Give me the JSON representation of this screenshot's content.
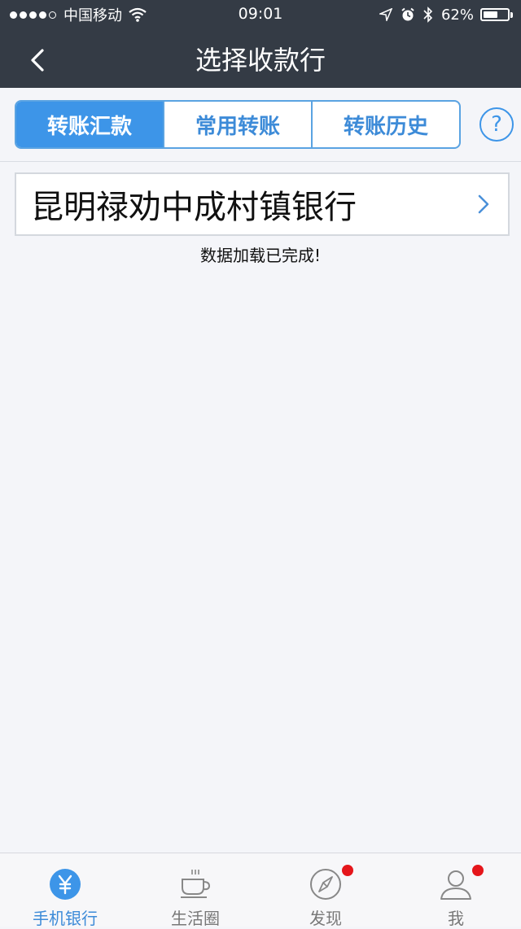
{
  "status": {
    "carrier": "中国移动",
    "time": "09:01",
    "battery": "62%",
    "battery_level": 0.62
  },
  "nav": {
    "title": "选择收款行"
  },
  "segments": [
    {
      "label": "转账汇款",
      "active": true
    },
    {
      "label": "常用转账",
      "active": false
    },
    {
      "label": "转账历史",
      "active": false
    }
  ],
  "help": {
    "label": "?"
  },
  "bank": {
    "name": "昆明禄劝中成村镇银行"
  },
  "load_message": "数据加载已完成!",
  "tabbar": [
    {
      "label": "手机银行",
      "icon": "yen-icon",
      "active": true,
      "badge": false
    },
    {
      "label": "生活圈",
      "icon": "coffee-cup-icon",
      "active": false,
      "badge": false
    },
    {
      "label": "发现",
      "icon": "compass-icon",
      "active": false,
      "badge": true
    },
    {
      "label": "我",
      "icon": "user-icon",
      "active": false,
      "badge": true
    }
  ],
  "colors": {
    "accent": "#3d95e8",
    "header": "#343b45",
    "badge": "#e5161b"
  }
}
